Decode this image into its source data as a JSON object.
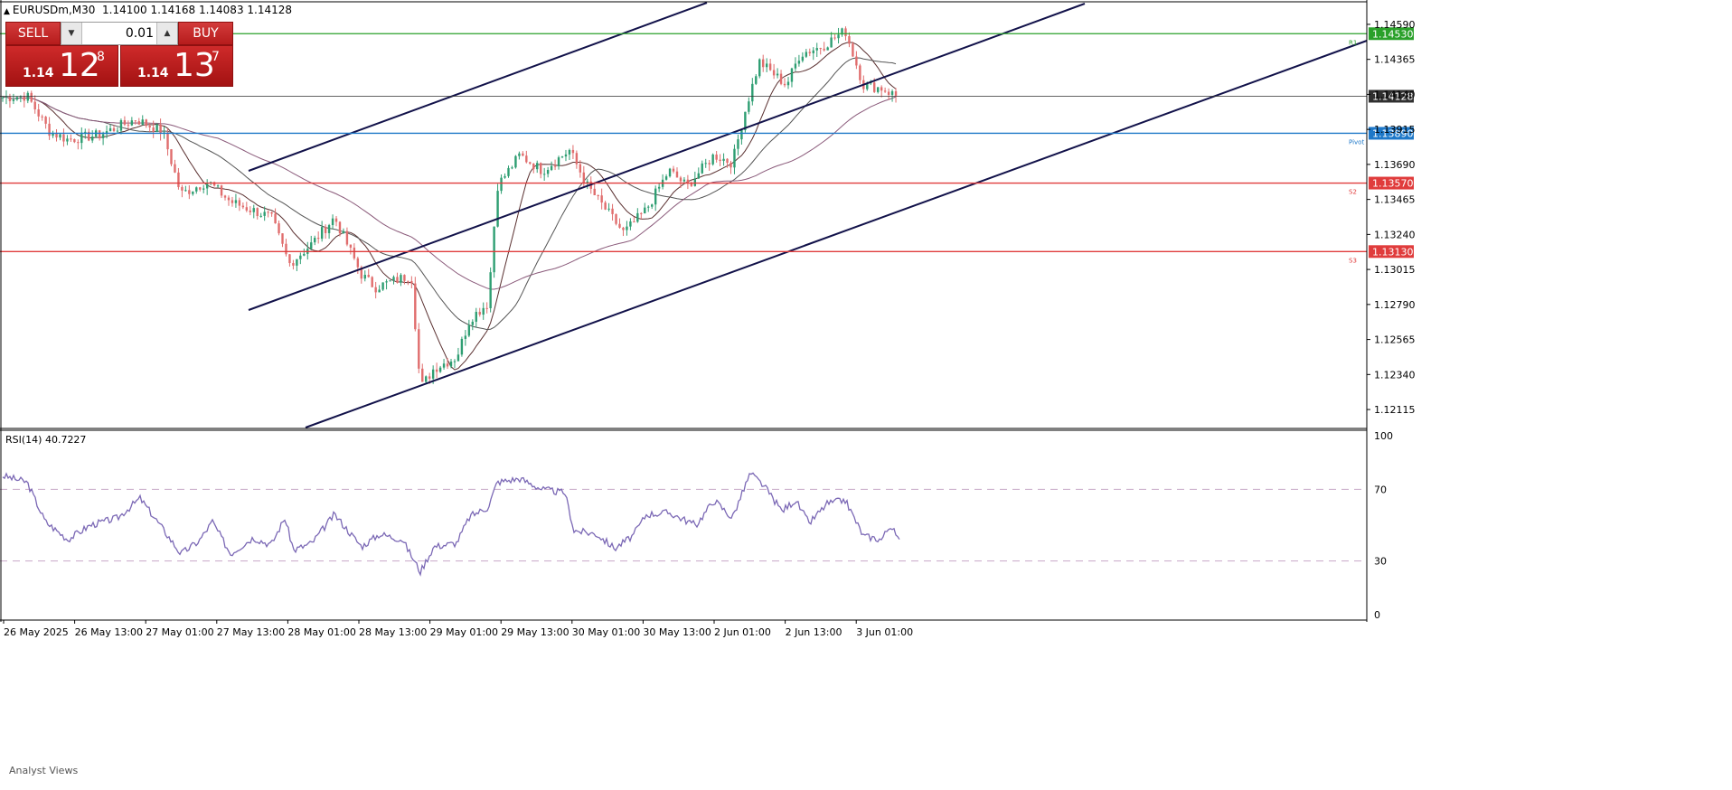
{
  "header": {
    "symbol": "EURUSDm,M30",
    "open": "1.14100",
    "high": "1.14168",
    "low": "1.14083",
    "close": "1.14128"
  },
  "trade_panel": {
    "sell_label": "SELL",
    "buy_label": "BUY",
    "lot_size": "0.01",
    "sell_price": {
      "prefix": "1.14",
      "big": "12",
      "sup": "8"
    },
    "buy_price": {
      "prefix": "1.14",
      "big": "13",
      "sup": "7"
    }
  },
  "price_axis": {
    "ticks": [
      "1.14590",
      "1.14365",
      "1.14140",
      "1.13915",
      "1.13690",
      "1.13465",
      "1.13240",
      "1.13015",
      "1.12790",
      "1.12565",
      "1.12340",
      "1.12115"
    ],
    "range": [
      1.12005,
      1.147
    ]
  },
  "levels": [
    {
      "label": "R1",
      "price": 1.1453,
      "price_text": "1.14530",
      "color": "#2aa02a"
    },
    {
      "label": "",
      "price": 1.14128,
      "price_text": "1.14128",
      "color": "#303030"
    },
    {
      "label": "Pivot",
      "price": 1.1389,
      "price_text": "1.13890",
      "color": "#1e78c8"
    },
    {
      "label": "S2",
      "price": 1.1357,
      "price_text": "1.13570",
      "color": "#e03c3c"
    },
    {
      "label": "S3",
      "price": 1.1313,
      "price_text": "1.13130",
      "color": "#e03c3c"
    }
  ],
  "time_axis": {
    "labels": [
      "26 May 2025",
      "26 May 13:00",
      "27 May 01:00",
      "27 May 13:00",
      "28 May 01:00",
      "28 May 13:00",
      "29 May 01:00",
      "29 May 13:00",
      "30 May 01:00",
      "30 May 13:00",
      "2 Jun 01:00",
      "2 Jun 13:00",
      "3 Jun 01:00"
    ]
  },
  "rsi": {
    "title": "RSI(14) 40.7227",
    "levels": [
      "100",
      "70",
      "30",
      "0"
    ],
    "line_color": "#7b68b5"
  },
  "footer": {
    "label": "Analyst Views"
  },
  "colors": {
    "bull": "#2e9e72",
    "bear": "#e06d6d",
    "channel": "#12124a"
  },
  "chart_data": {
    "type": "candlestick",
    "symbol": "EURUSDm",
    "timeframe": "M30",
    "anchors_price": [
      [
        0,
        1.1412
      ],
      [
        30,
        1.1413
      ],
      [
        55,
        1.139
      ],
      [
        75,
        1.1385
      ],
      [
        110,
        1.1388
      ],
      [
        150,
        1.1398
      ],
      [
        180,
        1.139
      ],
      [
        200,
        1.135
      ],
      [
        230,
        1.1358
      ],
      [
        255,
        1.1345
      ],
      [
        300,
        1.1335
      ],
      [
        320,
        1.1305
      ],
      [
        345,
        1.1318
      ],
      [
        370,
        1.1335
      ],
      [
        400,
        1.1298
      ],
      [
        415,
        1.129
      ],
      [
        455,
        1.1298
      ],
      [
        465,
        1.1225
      ],
      [
        480,
        1.1238
      ],
      [
        505,
        1.1245
      ],
      [
        520,
        1.127
      ],
      [
        540,
        1.128
      ],
      [
        550,
        1.1355
      ],
      [
        575,
        1.1375
      ],
      [
        600,
        1.1365
      ],
      [
        630,
        1.1378
      ],
      [
        650,
        1.1355
      ],
      [
        690,
        1.1325
      ],
      [
        715,
        1.134
      ],
      [
        740,
        1.1365
      ],
      [
        760,
        1.1355
      ],
      [
        790,
        1.1375
      ],
      [
        810,
        1.137
      ],
      [
        825,
        1.1405
      ],
      [
        840,
        1.1435
      ],
      [
        870,
        1.142
      ],
      [
        885,
        1.144
      ],
      [
        910,
        1.1445
      ],
      [
        935,
        1.1455
      ],
      [
        955,
        1.142
      ],
      [
        975,
        1.1418
      ],
      [
        995,
        1.1412
      ]
    ],
    "rsi_anchors": [
      [
        0,
        78
      ],
      [
        30,
        74
      ],
      [
        50,
        52
      ],
      [
        75,
        42
      ],
      [
        100,
        50
      ],
      [
        130,
        54
      ],
      [
        155,
        65
      ],
      [
        180,
        48
      ],
      [
        200,
        34
      ],
      [
        220,
        41
      ],
      [
        235,
        52
      ],
      [
        255,
        34
      ],
      [
        280,
        43
      ],
      [
        300,
        39
      ],
      [
        315,
        54
      ],
      [
        325,
        36
      ],
      [
        345,
        40
      ],
      [
        370,
        56
      ],
      [
        400,
        38
      ],
      [
        420,
        45
      ],
      [
        445,
        42
      ],
      [
        465,
        24
      ],
      [
        480,
        38
      ],
      [
        505,
        40
      ],
      [
        520,
        55
      ],
      [
        540,
        60
      ],
      [
        550,
        74
      ],
      [
        575,
        76
      ],
      [
        600,
        70
      ],
      [
        625,
        68
      ],
      [
        635,
        47
      ],
      [
        660,
        45
      ],
      [
        680,
        37
      ],
      [
        700,
        44
      ],
      [
        715,
        56
      ],
      [
        740,
        57
      ],
      [
        770,
        50
      ],
      [
        790,
        64
      ],
      [
        810,
        54
      ],
      [
        830,
        79
      ],
      [
        845,
        72
      ],
      [
        865,
        58
      ],
      [
        880,
        64
      ],
      [
        895,
        51
      ],
      [
        915,
        62
      ],
      [
        935,
        64
      ],
      [
        955,
        44
      ],
      [
        975,
        42
      ],
      [
        985,
        50
      ],
      [
        995,
        40.72
      ]
    ]
  }
}
